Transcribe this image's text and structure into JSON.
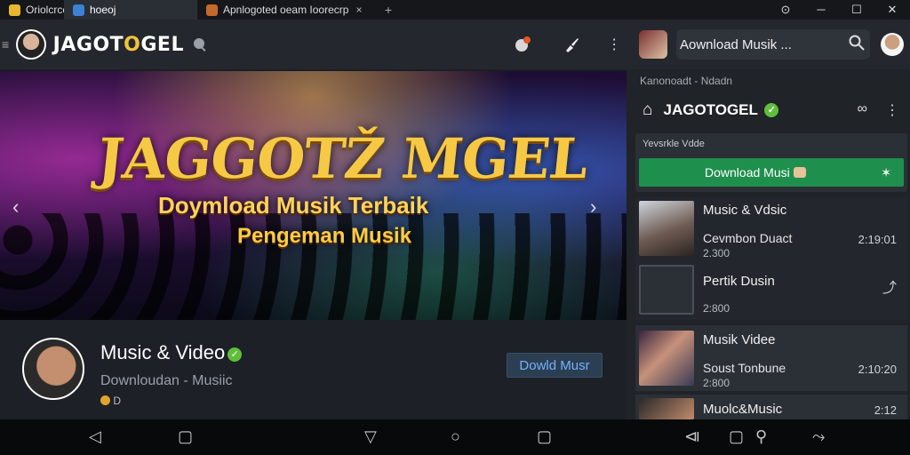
{
  "browser": {
    "tabs": [
      {
        "label": "Oriolcrce"
      },
      {
        "label": "hoeoj"
      },
      {
        "label": "Apnlogoted oeam  Ioorecrp"
      }
    ],
    "tab3_close": "×",
    "new_tab": "+"
  },
  "header": {
    "brand_pre": "JAGOT",
    "brand_o": "O",
    "brand_post": "GEL"
  },
  "search": {
    "query": "Aownload Musik ..."
  },
  "banner": {
    "title": "JAGGOTŽ MGEL",
    "subtitle": "Doymload Musik Terbaik",
    "subtitle2": "Pengeman Musik"
  },
  "channel": {
    "title": "Music & Video",
    "subtitle": "Downloudan - Musiic",
    "meta": "D",
    "button_label": "Dowld Musr"
  },
  "right_panel": {
    "header": "Kanonoadt - Ndadn",
    "title": "JAGOTOGEL",
    "featured_label": "Yevsrkle Vdde",
    "download_label": "Download Musi"
  },
  "list": [
    {
      "title": "Music & Vdsic",
      "subtitle": "Cevmbon Duact",
      "meta": "2.300",
      "time": "2:19:01"
    },
    {
      "title": "Pertik Dusin",
      "subtitle": "",
      "meta": "2:800",
      "time": ""
    },
    {
      "title": "Musik Videe",
      "subtitle": "Soust Tonbune",
      "meta": "2:800",
      "time": "2:10:20"
    },
    {
      "title": "Muolc&Music",
      "subtitle": "",
      "meta": "",
      "time": "2:12"
    }
  ],
  "colors": {
    "download_green": "#1f8f4e",
    "brand_gold": "#f2c33c",
    "link_blue": "#6fb3ff"
  }
}
